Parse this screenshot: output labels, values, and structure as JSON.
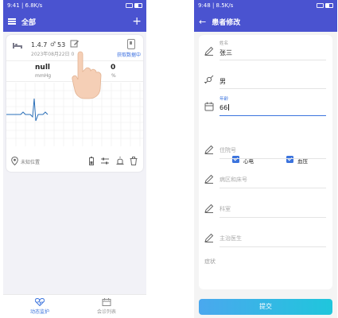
{
  "left_screen": {
    "status": {
      "time": "9:41",
      "speed": "6.8K/s"
    },
    "header": {
      "title": "全部",
      "add_label": "+"
    },
    "device_card": {
      "version": "1.4.7",
      "age": "53",
      "date": "2023年08月22日 0",
      "fetch_status": "获取数据中",
      "metric_1_value": "null",
      "metric_1_unit": "mmHg",
      "metric_2_value": "0",
      "metric_2_unit": "%",
      "location": "未知位置"
    },
    "tabs": [
      {
        "label": "动态监护",
        "color": "#3b73dd"
      },
      {
        "label": "会诊列表",
        "color": "#999999"
      }
    ]
  },
  "right_screen": {
    "status": {
      "time": "9:48",
      "speed": "8.5K/s"
    },
    "header": {
      "title": "患者修改",
      "back_label": "←"
    },
    "fields": {
      "name_label": "姓名",
      "name_value": "张三",
      "gender_value": "男",
      "age_label": "年龄",
      "age_value": "66",
      "hospital_no_placeholder": "住院号",
      "ward_bed_placeholder": "病区和床号",
      "department_placeholder": "科室",
      "doctor_placeholder": "主治医生",
      "remark_placeholder": "症状"
    },
    "checks": {
      "ecg_label": "心电",
      "bp_label": "血压",
      "ecg_checked": true,
      "bp_checked": true
    },
    "submit_label": "提交"
  },
  "colors": {
    "brand": "#4a53d0",
    "accent": "#3b73dd"
  }
}
